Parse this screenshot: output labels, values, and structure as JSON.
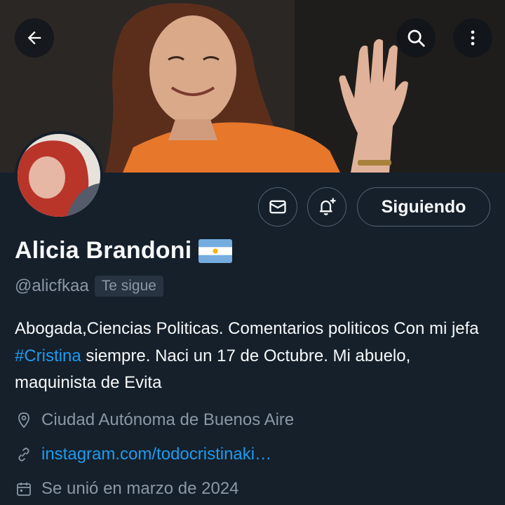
{
  "header": {
    "back_icon": "arrow-left-icon",
    "search_icon": "search-icon",
    "more_icon": "more-vertical-icon"
  },
  "profile": {
    "name": "Alicia Brandoni",
    "flag_emoji": "🇦🇷",
    "handle": "@alicfkaa",
    "follows_you": "Te sigue",
    "bio_part1": "Abogada,Ciencias Politicas. Comentarios politicos Con mi jefa ",
    "bio_hashtag": "#Cristina",
    "bio_part2": " siempre. Naci un 17 de Octubre. Mi abuelo, maquinista de Evita",
    "location": "Ciudad Autónoma de Buenos Aire",
    "website": "instagram.com/todocristinaki…",
    "joined": "Se unió en marzo de 2024"
  },
  "actions": {
    "message_icon": "mail-icon",
    "notify_icon": "bell-plus-icon",
    "follow_state_label": "Siguiendo"
  },
  "colors": {
    "background": "#15202b",
    "text_primary": "#f7f9f9",
    "text_secondary": "#8b98a5",
    "link": "#1d9bf0",
    "border": "#536471"
  }
}
